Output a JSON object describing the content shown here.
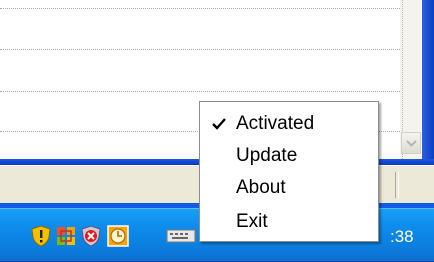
{
  "context_menu": {
    "items": [
      {
        "label": "Activated",
        "checked": true
      },
      {
        "label": "Update",
        "checked": false
      },
      {
        "label": "About",
        "checked": false
      },
      {
        "label": "Exit",
        "checked": false
      }
    ]
  },
  "tray": {
    "clock_partial": ":38",
    "icons": [
      "security-shield-icon",
      "network-grid-icon",
      "antivirus-shield-icon",
      "clock-app-icon",
      "keyboard-icon"
    ]
  },
  "colors": {
    "taskbar": "#0f8eee",
    "window_frame": "#0a3fc4",
    "statusbar": "#ece9d8",
    "menu_border": "#8d8d8d"
  }
}
